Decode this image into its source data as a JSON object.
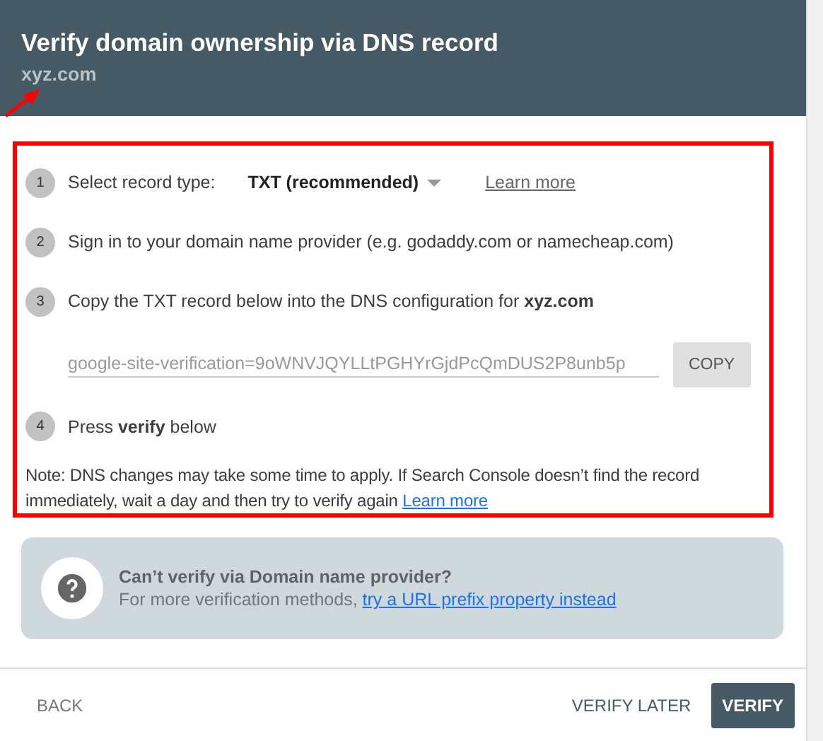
{
  "dialog": {
    "title": "Verify domain ownership via DNS record",
    "subtitle": "xyz.com"
  },
  "steps": [
    {
      "number": "1",
      "kind": "select",
      "label": "Select record type:",
      "value": "TXT (recommended)",
      "link": "Learn more"
    },
    {
      "number": "2",
      "kind": "text",
      "text": "Sign in to your domain name provider (e.g. godaddy.com or namecheap.com)"
    },
    {
      "number": "3",
      "kind": "text",
      "text": "Copy the TXT record below into the DNS configuration for **xyz.com**"
    },
    {
      "kind": "record",
      "value": "google-site-verification=9oWNVJQYLLtPGHYrGjdPcQmDUS2P8unb5p",
      "button": "COPY"
    },
    {
      "number": "4",
      "kind": "text",
      "text": "Press **verify** below"
    }
  ],
  "note": {
    "text": "Note: DNS changes may take some time to apply. If Search Console doesn’t find the record immediately, wait a day and then try to verify again",
    "link": "Learn more"
  },
  "help": {
    "title": "Can’t verify via Domain name provider?",
    "text": "For more verification methods,",
    "link": "try a URL prefix property instead"
  },
  "footer": {
    "back": "BACK",
    "later": "VERIFY LATER",
    "verify": "VERIFY"
  }
}
